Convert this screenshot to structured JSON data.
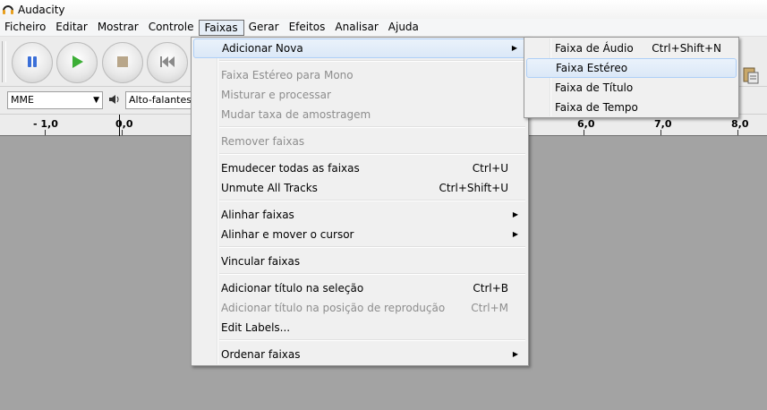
{
  "window": {
    "title": "Audacity"
  },
  "menubar": {
    "items": [
      "Ficheiro",
      "Editar",
      "Mostrar",
      "Controle",
      "Faixas",
      "Gerar",
      "Efeitos",
      "Analisar",
      "Ajuda"
    ],
    "active": "Faixas"
  },
  "device": {
    "host": "MME",
    "output": "Alto-falantes ("
  },
  "ruler": {
    "labels": [
      "- 1,0",
      "0,0",
      "6,0",
      "7,0",
      "8,0"
    ]
  },
  "faixas_menu": {
    "add_new": "Adicionar Nova",
    "stereo_to_mono": "Faixa Estéreo para Mono",
    "mix_render": "Misturar e processar",
    "resample": "Mudar taxa de amostragem",
    "remove_tracks": "Remover faixas",
    "mute_all": {
      "label": "Emudecer todas as faixas",
      "shortcut": "Ctrl+U"
    },
    "unmute_all": {
      "label": "Unmute All Tracks",
      "shortcut": "Ctrl+Shift+U"
    },
    "align_tracks": "Alinhar faixas",
    "align_move_cursor": "Alinhar e mover o cursor",
    "link_tracks": "Vincular faixas",
    "add_label_selection": {
      "label": "Adicionar título na seleção",
      "shortcut": "Ctrl+B"
    },
    "add_label_playback": {
      "label": "Adicionar título na posição de reprodução",
      "shortcut": "Ctrl+M"
    },
    "edit_labels": "Edit Labels...",
    "sort_tracks": "Ordenar faixas"
  },
  "add_new_submenu": {
    "audio_track": {
      "label": "Faixa de Áudio",
      "shortcut": "Ctrl+Shift+N"
    },
    "stereo_track": "Faixa Estéreo",
    "label_track": "Faixa de Título",
    "time_track": "Faixa de Tempo"
  },
  "icons": {
    "pause": "pause-icon",
    "play": "play-icon",
    "stop": "stop-icon",
    "skip_start": "skip-to-start-icon",
    "speaker": "speaker-icon",
    "paste": "paste-icon"
  },
  "colors": {
    "accent_pause": "#3b6fd8",
    "accent_play": "#3cae36",
    "workspace": "#a3a3a3",
    "menu_hover": "#dbe8f7"
  }
}
